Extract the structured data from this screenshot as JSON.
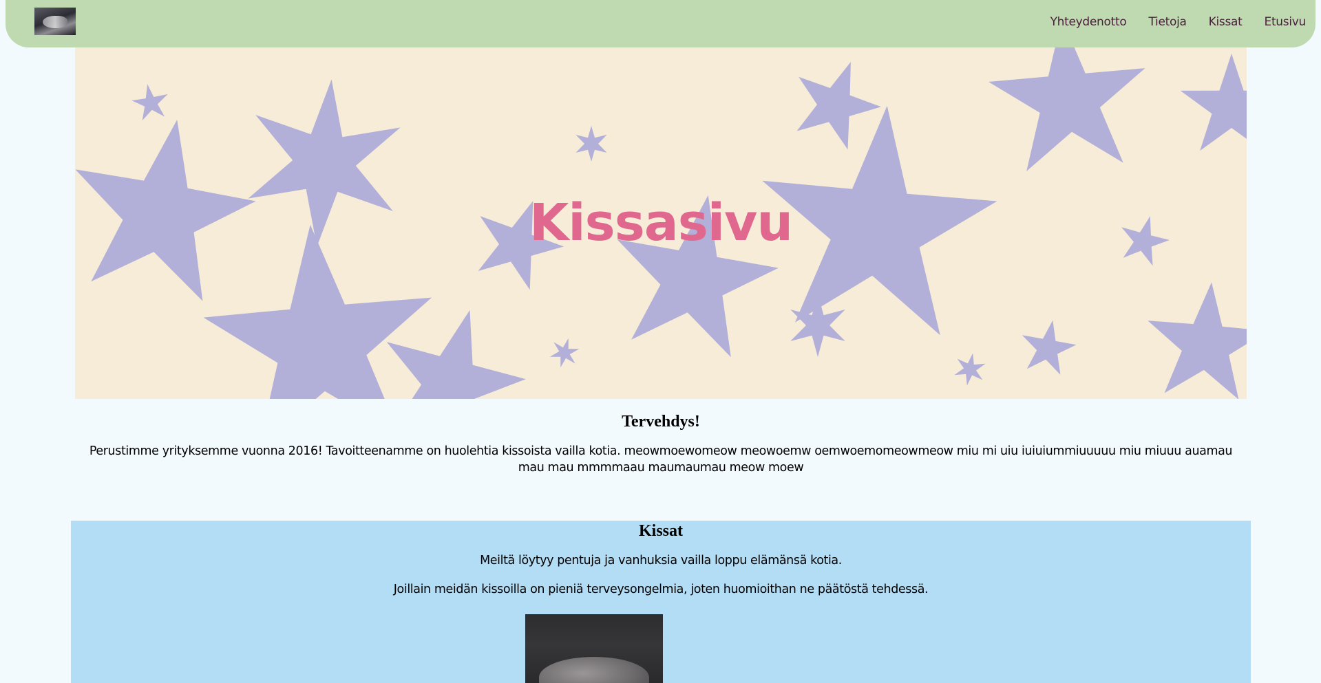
{
  "nav": {
    "logo_alt": "kissa-logo",
    "links": [
      "Yhteydenotto",
      "Tietoja",
      "Kissat",
      "Etusivu"
    ]
  },
  "hero": {
    "title": "Kissasivu"
  },
  "intro": {
    "heading": "Tervehdys!",
    "text": "Perustimme yrityksemme vuonna 2016! Tavoitteenamme on huolehtia kissoista vailla kotia. meowmoewomeow meowoemw oemwoemomeowmeow miu mi uiu iuiuiummiuuuuu miu miuuu auamau mau mau mmmmaau maumaumau meow moew"
  },
  "cats": {
    "heading": "Kissat",
    "line1": "Meiltä löytyy pentuja ja vanhuksia vailla loppu elämänsä kotia.",
    "line2": "Joillain meidän kissoilla on pieniä terveysongelmia, joten huomioithan ne päätöstä tehdessä."
  },
  "colors": {
    "navbar": "#bfdab1",
    "hero_bg": "#f6ecd7",
    "stars": "#b2afd8",
    "title": "#e0688f",
    "cats_bg": "#b3ddf5",
    "page_bg": "#f3fafd",
    "nav_text": "#4a1f3c"
  }
}
